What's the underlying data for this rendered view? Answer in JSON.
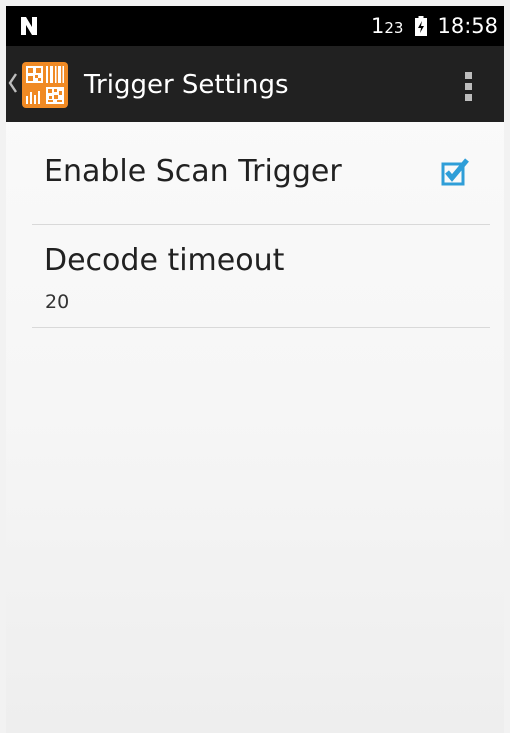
{
  "status_bar": {
    "notification_icon": "n-notification-icon",
    "network_main": "1",
    "network_sub": "23",
    "battery_icon": "battery-charging-icon",
    "time": "18:58"
  },
  "action_bar": {
    "back_icon": "chevron-left-icon",
    "app_icon": "barcode-scanner-app-icon",
    "app_icon_color": "#f08a24",
    "title": "Trigger Settings",
    "overflow_icon": "overflow-menu-icon"
  },
  "preferences": [
    {
      "title": "Enable Scan Trigger",
      "checked": true,
      "checkbox_color": "#2f9ed8"
    },
    {
      "title": "Decode timeout",
      "summary": "20"
    }
  ],
  "colors": {
    "status_bar": "#000000",
    "action_bar": "#212121",
    "background": "#f7f7f7",
    "divider": "#d9d9d9"
  }
}
